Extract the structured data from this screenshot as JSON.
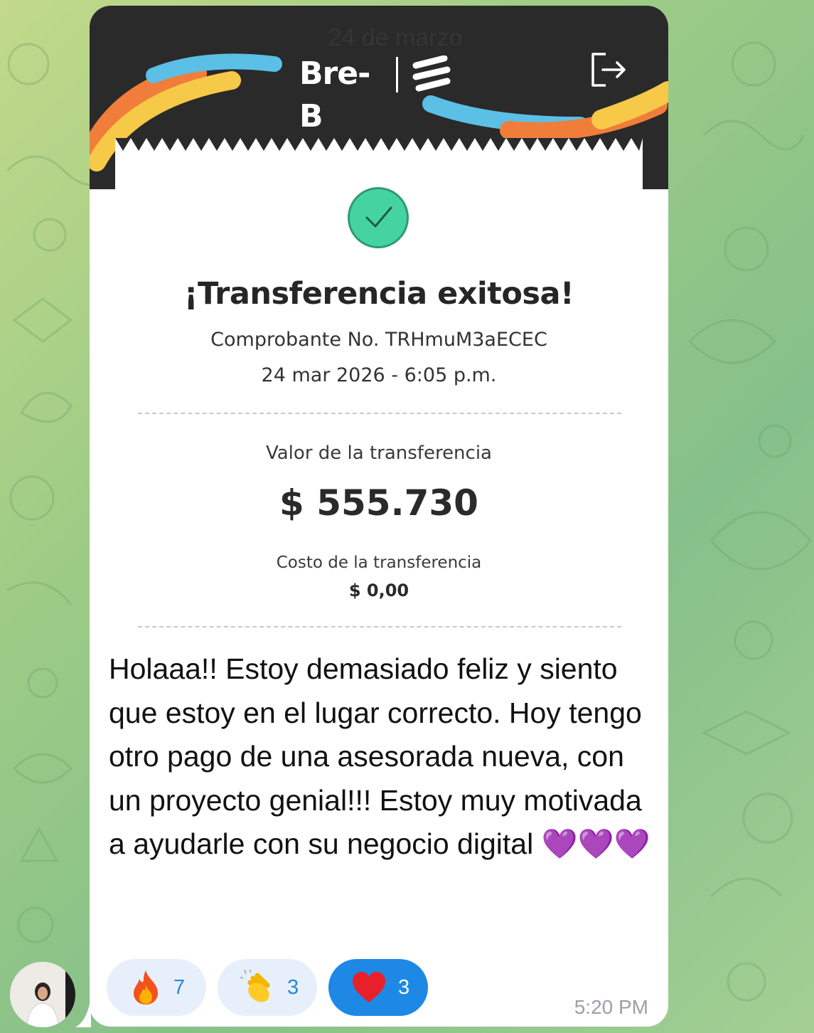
{
  "receipt": {
    "date_overlay": "24 de marzo",
    "brand": "Bre-B",
    "title": "¡Transferencia exitosa!",
    "receipt_number": "Comprobante No. TRHmuM3aECEC",
    "datetime": "24 mar 2026 - 6:05 p.m.",
    "value_label": "Valor de la transferencia",
    "value_amount": "$ 555.730",
    "cost_label": "Costo de la transferencia",
    "cost_amount": "$ 0,00"
  },
  "message": {
    "text": "Holaaa!! Estoy demasiado feliz y siento que estoy en el lugar correcto. Hoy tengo otro pago de una asesorada nueva, con un proyecto genial!!! Estoy muy motivada a ayudarle con su negocio digital 💜💜💜",
    "time": "5:20 PM"
  },
  "reactions": [
    {
      "icon": "fire-emoji",
      "count": "7",
      "active": false
    },
    {
      "icon": "clapping-hands-emoji",
      "count": "3",
      "active": false
    },
    {
      "icon": "red-heart-emoji",
      "count": "3",
      "active": true
    }
  ],
  "colors": {
    "header_dark": "#2a2a2a",
    "accent_green": "#45d3a2",
    "reaction_active": "#1e88e5",
    "reaction_idle": "#e7f0fa",
    "stripe_blue": "#5bbfe6",
    "stripe_yellow": "#f7c948",
    "stripe_orange": "#f07e3a"
  }
}
